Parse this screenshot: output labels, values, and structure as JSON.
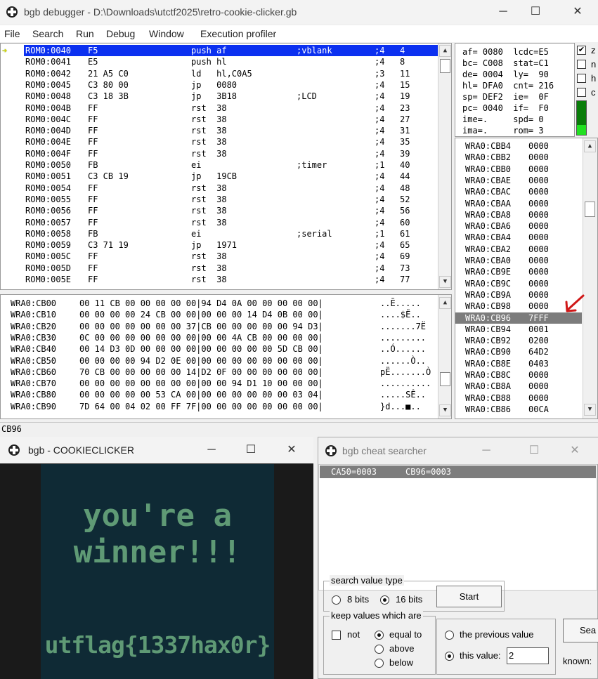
{
  "debugger": {
    "title": "bgb debugger - D:\\Downloads\\utctf2025\\retro-cookie-clicker.gb",
    "menu": [
      "File",
      "Search",
      "Run",
      "Debug",
      "Window",
      "Execution profiler"
    ],
    "disasm": [
      {
        "addr": "ROM0:0040",
        "bytes": "F5",
        "op": "push af",
        "comment": ";vblank",
        "cyc": ";4",
        "total": "4",
        "current": true
      },
      {
        "addr": "ROM0:0041",
        "bytes": "E5",
        "op": "push hl",
        "comment": "",
        "cyc": ";4",
        "total": "8"
      },
      {
        "addr": "ROM0:0042",
        "bytes": "21 A5 C0",
        "op": "ld   hl,C0A5",
        "comment": "",
        "cyc": ";3",
        "total": "11"
      },
      {
        "addr": "ROM0:0045",
        "bytes": "C3 80 00",
        "op": "jp   0080",
        "comment": "",
        "cyc": ";4",
        "total": "15"
      },
      {
        "addr": "ROM0:0048",
        "bytes": "C3 18 3B",
        "op": "jp   3B18",
        "comment": ";LCD",
        "cyc": ";4",
        "total": "19"
      },
      {
        "addr": "ROM0:004B",
        "bytes": "FF",
        "op": "rst  38",
        "comment": "",
        "cyc": ";4",
        "total": "23"
      },
      {
        "addr": "ROM0:004C",
        "bytes": "FF",
        "op": "rst  38",
        "comment": "",
        "cyc": ";4",
        "total": "27"
      },
      {
        "addr": "ROM0:004D",
        "bytes": "FF",
        "op": "rst  38",
        "comment": "",
        "cyc": ";4",
        "total": "31"
      },
      {
        "addr": "ROM0:004E",
        "bytes": "FF",
        "op": "rst  38",
        "comment": "",
        "cyc": ";4",
        "total": "35"
      },
      {
        "addr": "ROM0:004F",
        "bytes": "FF",
        "op": "rst  38",
        "comment": "",
        "cyc": ";4",
        "total": "39"
      },
      {
        "addr": "ROM0:0050",
        "bytes": "FB",
        "op": "ei",
        "comment": ";timer",
        "cyc": ";1",
        "total": "40"
      },
      {
        "addr": "ROM0:0051",
        "bytes": "C3 CB 19",
        "op": "jp   19CB",
        "comment": "",
        "cyc": ";4",
        "total": "44"
      },
      {
        "addr": "ROM0:0054",
        "bytes": "FF",
        "op": "rst  38",
        "comment": "",
        "cyc": ";4",
        "total": "48"
      },
      {
        "addr": "ROM0:0055",
        "bytes": "FF",
        "op": "rst  38",
        "comment": "",
        "cyc": ";4",
        "total": "52"
      },
      {
        "addr": "ROM0:0056",
        "bytes": "FF",
        "op": "rst  38",
        "comment": "",
        "cyc": ";4",
        "total": "56"
      },
      {
        "addr": "ROM0:0057",
        "bytes": "FF",
        "op": "rst  38",
        "comment": "",
        "cyc": ";4",
        "total": "60"
      },
      {
        "addr": "ROM0:0058",
        "bytes": "FB",
        "op": "ei",
        "comment": ";serial",
        "cyc": ";1",
        "total": "61"
      },
      {
        "addr": "ROM0:0059",
        "bytes": "C3 71 19",
        "op": "jp   1971",
        "comment": "",
        "cyc": ";4",
        "total": "65"
      },
      {
        "addr": "ROM0:005C",
        "bytes": "FF",
        "op": "rst  38",
        "comment": "",
        "cyc": ";4",
        "total": "69"
      },
      {
        "addr": "ROM0:005D",
        "bytes": "FF",
        "op": "rst  38",
        "comment": "",
        "cyc": ";4",
        "total": "73"
      },
      {
        "addr": "ROM0:005E",
        "bytes": "FF",
        "op": "rst  38",
        "comment": "",
        "cyc": ";4",
        "total": "77"
      }
    ],
    "registers": [
      "af= 0080  lcdc=E5",
      "bc= C008  stat=C1",
      "de= 0004  ly=  90",
      "hl= DFA0  cnt= 216",
      "sp= DEF2  ie=  0F",
      "pc= 0040  if=  F0",
      "ime=.     spd= 0",
      "ima=.     rom= 3"
    ],
    "flags": [
      {
        "label": "z",
        "checked": true
      },
      {
        "label": "n",
        "checked": false
      },
      {
        "label": "h",
        "checked": false
      },
      {
        "label": "c",
        "checked": false
      }
    ],
    "stack": [
      {
        "addr": "WRA0:CBB4",
        "val": "0000"
      },
      {
        "addr": "WRA0:CBB2",
        "val": "0000"
      },
      {
        "addr": "WRA0:CBB0",
        "val": "0000"
      },
      {
        "addr": "WRA0:CBAE",
        "val": "0000"
      },
      {
        "addr": "WRA0:CBAC",
        "val": "0000"
      },
      {
        "addr": "WRA0:CBAA",
        "val": "0000"
      },
      {
        "addr": "WRA0:CBA8",
        "val": "0000"
      },
      {
        "addr": "WRA0:CBA6",
        "val": "0000"
      },
      {
        "addr": "WRA0:CBA4",
        "val": "0000"
      },
      {
        "addr": "WRA0:CBA2",
        "val": "0000"
      },
      {
        "addr": "WRA0:CBA0",
        "val": "0000"
      },
      {
        "addr": "WRA0:CB9E",
        "val": "0000"
      },
      {
        "addr": "WRA0:CB9C",
        "val": "0000"
      },
      {
        "addr": "WRA0:CB9A",
        "val": "0000"
      },
      {
        "addr": "WRA0:CB98",
        "val": "0000"
      },
      {
        "addr": "WRA0:CB96",
        "val": "7FFF",
        "selected": true
      },
      {
        "addr": "WRA0:CB94",
        "val": "0001"
      },
      {
        "addr": "WRA0:CB92",
        "val": "0200"
      },
      {
        "addr": "WRA0:CB90",
        "val": "64D2"
      },
      {
        "addr": "WRA0:CB8E",
        "val": "0403"
      },
      {
        "addr": "WRA0:CB8C",
        "val": "0000"
      },
      {
        "addr": "WRA0:CB8A",
        "val": "0000"
      },
      {
        "addr": "WRA0:CB88",
        "val": "0000"
      },
      {
        "addr": "WRA0:CB86",
        "val": "00CA"
      }
    ],
    "memory": [
      {
        "addr": "WRA0:CB00",
        "hex": "00 11 CB 00 00 00 00 00|94 D4 0A 00 00 00 00 00|",
        "ascii": "..Ë....."
      },
      {
        "addr": "WRA0:CB10",
        "hex": "00 00 00 00 24 CB 00 00|00 00 00 14 D4 0B 00 00|",
        "ascii": "....$Ë.."
      },
      {
        "addr": "WRA0:CB20",
        "hex": "00 00 00 00 00 00 00 37|CB 00 00 00 00 00 94 D3|",
        "ascii": ".......7Ë"
      },
      {
        "addr": "WRA0:CB30",
        "hex": "0C 00 00 00 00 00 00 00|00 00 4A CB 00 00 00 00|",
        "ascii": "........."
      },
      {
        "addr": "WRA0:CB40",
        "hex": "00 14 D3 0D 00 00 00 00|00 00 00 00 00 5D CB 00|",
        "ascii": "..Ó......"
      },
      {
        "addr": "WRA0:CB50",
        "hex": "00 00 00 00 94 D2 0E 00|00 00 00 00 00 00 00 00|",
        "ascii": "......Ò.."
      },
      {
        "addr": "WRA0:CB60",
        "hex": "70 CB 00 00 00 00 00 14|D2 0F 00 00 00 00 00 00|",
        "ascii": "pË.......Ò"
      },
      {
        "addr": "WRA0:CB70",
        "hex": "00 00 00 00 00 00 00 00|00 00 94 D1 10 00 00 00|",
        "ascii": ".........."
      },
      {
        "addr": "WRA0:CB80",
        "hex": "00 00 00 00 00 53 CA 00|00 00 00 00 00 00 03 04|",
        "ascii": ".....SÊ.."
      },
      {
        "addr": "WRA0:CB90",
        "hex": "7D 64 00 04 02 00 FF 7F|00 00 00 00 00 00 00 00|",
        "ascii": "}d...■.."
      }
    ],
    "status": "CB96"
  },
  "game": {
    "title": "bgb - COOKIECLICKER",
    "line1": "you're a",
    "line2": "winner!!!",
    "flag": "utflag{1337hax0r}"
  },
  "cheat": {
    "title": "bgb cheat searcher",
    "results": [
      "CA50=0003",
      "CB96=0003"
    ],
    "value_type_label": "search value type",
    "opt_8": "8 bits",
    "opt_16": "16 bits",
    "start": "Start",
    "keep_label": "keep values which are",
    "not": "not",
    "equal": "equal to",
    "above": "above",
    "below": "below",
    "prev": "the previous value",
    "this_value": "this value:",
    "value": "2",
    "search": "Sea",
    "known": "known:"
  },
  "colors": {
    "highlight": "#0b30f0",
    "gb_bg": "#0f2a35",
    "gb_fg": "#5f9a75",
    "arrow": "#d01818"
  }
}
